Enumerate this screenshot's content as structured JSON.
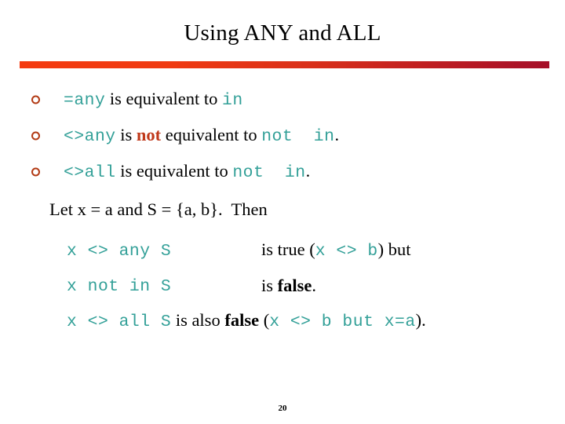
{
  "slide": {
    "title": "Using ANY and ALL",
    "page_number": "20",
    "accent_bar": {
      "gradient_start": "#F43A10",
      "gradient_end": "#A50F29"
    },
    "colors": {
      "code_teal": "#33A098",
      "keyword_red": "#C0391B",
      "bullet_marker": "#B23A14",
      "body_text": "#000000"
    },
    "bullet_marker_icon": "open-circle-bullet",
    "bullets": [
      {
        "parts": [
          {
            "text": "=any",
            "style": "mono"
          },
          {
            "text": " is equivalent to ",
            "style": "serif"
          },
          {
            "text": "in",
            "style": "mono"
          }
        ]
      },
      {
        "parts": [
          {
            "text": "<>any",
            "style": "mono"
          },
          {
            "text": " is ",
            "style": "serif"
          },
          {
            "text": "not",
            "style": "red-bold"
          },
          {
            "text": " equivalent to ",
            "style": "serif"
          },
          {
            "text": "not  in",
            "style": "mono"
          },
          {
            "text": ".",
            "style": "serif"
          }
        ]
      },
      {
        "parts": [
          {
            "text": "<>all",
            "style": "mono"
          },
          {
            "text": " is equivalent to ",
            "style": "serif"
          },
          {
            "text": "not  in",
            "style": "mono"
          },
          {
            "text": ".",
            "style": "serif"
          }
        ]
      }
    ],
    "example": {
      "lead_in": "Let x = a and S = {a, b}.  Then",
      "rows": [
        {
          "expr_parts": [
            {
              "text": "x <> any S",
              "style": "mono"
            }
          ],
          "result_parts": [
            {
              "text": "is true (",
              "style": "serif"
            },
            {
              "text": "x <> b",
              "style": "mono"
            },
            {
              "text": ") but",
              "style": "serif"
            }
          ]
        },
        {
          "expr_parts": [
            {
              "text": "x not in S",
              "style": "mono"
            }
          ],
          "result_parts": [
            {
              "text": "is ",
              "style": "serif"
            },
            {
              "text": "false",
              "style": "black-bold"
            },
            {
              "text": ".",
              "style": "serif"
            }
          ]
        },
        {
          "flow": true,
          "expr_parts": [
            {
              "text": "x <> all S",
              "style": "mono"
            }
          ],
          "result_parts": [
            {
              "text": " is also ",
              "style": "serif"
            },
            {
              "text": "false",
              "style": "black-bold"
            },
            {
              "text": " (",
              "style": "serif"
            },
            {
              "text": "x <> b but x=a",
              "style": "mono"
            },
            {
              "text": ").",
              "style": "serif"
            }
          ]
        }
      ]
    }
  }
}
